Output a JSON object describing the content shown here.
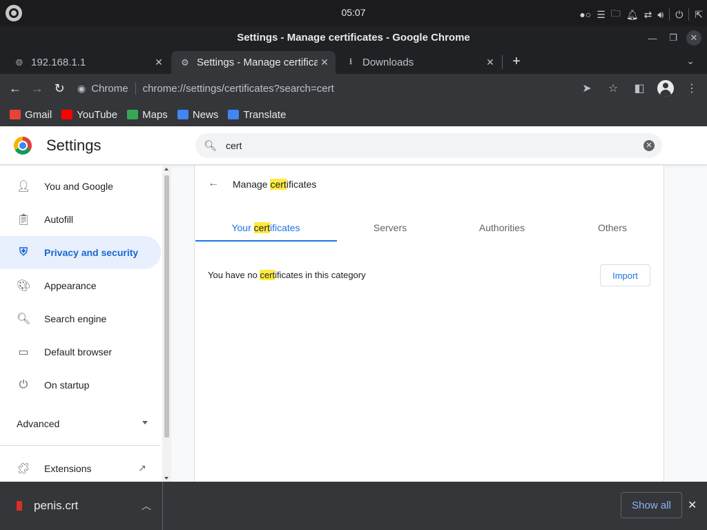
{
  "os": {
    "clock": "05:07"
  },
  "window": {
    "title": "Settings - Manage certificates - Google Chrome"
  },
  "tabs": [
    {
      "label": "192.168.1.1",
      "icon": "globe-icon"
    },
    {
      "label": "Settings - Manage certificates",
      "icon": "gear-icon",
      "active": true
    },
    {
      "label": "Downloads",
      "icon": "download-icon"
    }
  ],
  "toolbar": {
    "site_label": "Chrome",
    "url": "chrome://settings/certificates?search=cert"
  },
  "bookmarks": [
    {
      "label": "Gmail",
      "color": "#ea4335"
    },
    {
      "label": "YouTube",
      "color": "#ff0000"
    },
    {
      "label": "Maps",
      "color": "#34a853"
    },
    {
      "label": "News",
      "color": "#4285f4"
    },
    {
      "label": "Translate",
      "color": "#4285f4"
    }
  ],
  "settings": {
    "title": "Settings",
    "search_value": "cert",
    "nav": [
      {
        "label": "You and Google",
        "icon": "person-icon"
      },
      {
        "label": "Autofill",
        "icon": "clipboard-icon"
      },
      {
        "label": "Privacy and security",
        "icon": "shield-icon",
        "active": true
      },
      {
        "label": "Appearance",
        "icon": "palette-icon"
      },
      {
        "label": "Search engine",
        "icon": "search-icon"
      },
      {
        "label": "Default browser",
        "icon": "browser-icon"
      },
      {
        "label": "On startup",
        "icon": "power-icon"
      }
    ],
    "advanced": "Advanced",
    "extensions": "Extensions"
  },
  "certificates": {
    "heading_pre": "Manage ",
    "heading_match": "cert",
    "heading_post": "ificates",
    "tabs": [
      {
        "pre": "Your ",
        "match": "cert",
        "post": "ificates",
        "active": true
      },
      {
        "label": "Servers"
      },
      {
        "label": "Authorities"
      },
      {
        "label": "Others"
      }
    ],
    "empty_pre": "You have no ",
    "empty_match": "cert",
    "empty_post": "ificates in this category",
    "import_label": "Import",
    "accent": "#1a73e8",
    "highlight": "#ffeb3b"
  },
  "downloads": {
    "filename": "penis.crt",
    "show_all": "Show all"
  }
}
